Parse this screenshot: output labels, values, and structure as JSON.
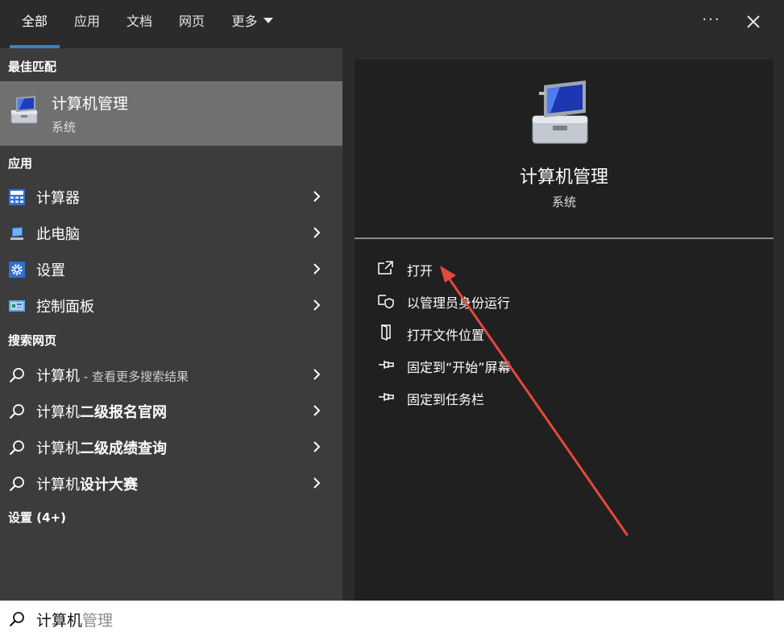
{
  "tabs": [
    {
      "label": "全部",
      "active": true
    },
    {
      "label": "应用"
    },
    {
      "label": "文档"
    },
    {
      "label": "网页"
    },
    {
      "label": "更多"
    }
  ],
  "more_icon": "more-options-icon",
  "close_icon": "close-icon",
  "left": {
    "best_match_heading": "最佳匹配",
    "best_match": {
      "title": "计算机管理",
      "subtitle": "系统",
      "icon": "computer-management-icon"
    },
    "apps_heading": "应用",
    "apps": [
      {
        "label": "计算器",
        "icon": "calculator-icon"
      },
      {
        "label": "此电脑",
        "icon": "this-pc-icon"
      },
      {
        "label": "设置",
        "icon": "settings-gear-icon"
      },
      {
        "label": "控制面板",
        "icon": "control-panel-icon"
      }
    ],
    "web_heading": "搜索网页",
    "web": [
      {
        "prefix": "计算机",
        "bold": "",
        "hint": " - 查看更多搜索结果"
      },
      {
        "prefix": "计算机",
        "bold": "二级报名官网",
        "hint": ""
      },
      {
        "prefix": "计算机",
        "bold": "二级成绩查询",
        "hint": ""
      },
      {
        "prefix": "计算机",
        "bold": "设计大赛",
        "hint": ""
      }
    ],
    "settings_heading": "设置 (4+)"
  },
  "right": {
    "title": "计算机管理",
    "subtitle": "系统",
    "actions": [
      {
        "label": "打开",
        "icon": "open-icon"
      },
      {
        "label": "以管理员身份运行",
        "icon": "run-as-admin-shield-icon"
      },
      {
        "label": "打开文件位置",
        "icon": "file-location-icon"
      },
      {
        "label": "固定到“开始”屏幕",
        "icon": "pin-icon"
      },
      {
        "label": "固定到任务栏",
        "icon": "pin-icon"
      }
    ]
  },
  "search": {
    "typed": "计算机",
    "suggestion": "管理"
  },
  "colors": {
    "accent": "#3b82c4",
    "annotation_arrow": "#e8473c"
  }
}
